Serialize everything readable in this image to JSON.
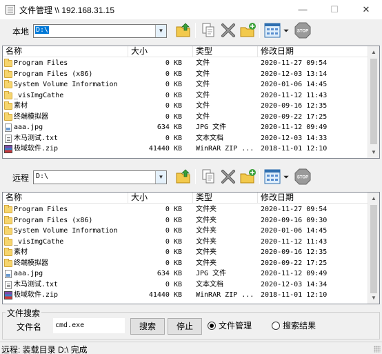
{
  "window": {
    "title": "文件管理 \\\\ 192.168.31.15",
    "min_glyph": "—",
    "max_glyph": "☐",
    "close_glyph": "✕"
  },
  "local": {
    "label": "本地",
    "path": "D:\\"
  },
  "remote": {
    "label": "远程",
    "path": "D:\\"
  },
  "toolbar": {
    "icons": [
      "folder-up-icon",
      "copy-icon",
      "delete-icon",
      "new-folder-icon",
      "view-mode-icon",
      "view-dropdown-icon",
      "stop-icon"
    ],
    "stop_label": "STOP"
  },
  "columns": {
    "name": "名称",
    "size": "大小",
    "type": "类型",
    "date": "修改日期"
  },
  "local_files": [
    {
      "icon": "folder",
      "name": "Program Files",
      "size": "0 KB",
      "type": "文件",
      "date": "2020-11-27 09:54"
    },
    {
      "icon": "folder",
      "name": "Program Files (x86)",
      "size": "0 KB",
      "type": "文件",
      "date": "2020-12-03 13:14"
    },
    {
      "icon": "folder",
      "name": "System Volume Information",
      "size": "0 KB",
      "type": "文件",
      "date": "2020-01-06 14:45"
    },
    {
      "icon": "folder",
      "name": "_visImgCathe",
      "size": "0 KB",
      "type": "文件",
      "date": "2020-11-12 11:43"
    },
    {
      "icon": "folder",
      "name": "素材",
      "size": "0 KB",
      "type": "文件",
      "date": "2020-09-16 12:35"
    },
    {
      "icon": "folder",
      "name": "终端模拟器",
      "size": "0 KB",
      "type": "文件",
      "date": "2020-09-22 17:25"
    },
    {
      "icon": "image",
      "name": "aaa.jpg",
      "size": "634 KB",
      "type": "JPG 文件",
      "date": "2020-11-12 09:49"
    },
    {
      "icon": "text",
      "name": "木马测试.txt",
      "size": "0 KB",
      "type": "文本文档",
      "date": "2020-12-03 14:33"
    },
    {
      "icon": "zip",
      "name": "极域软件.zip",
      "size": "41440 KB",
      "type": "WinRAR ZIP ...",
      "date": "2018-11-01 12:10"
    }
  ],
  "remote_files": [
    {
      "icon": "folder",
      "name": "Program Files",
      "size": "0 KB",
      "type": "文件夹",
      "date": "2020-11-27 09:54"
    },
    {
      "icon": "folder",
      "name": "Program Files (x86)",
      "size": "0 KB",
      "type": "文件夹",
      "date": "2020-09-16 09:30"
    },
    {
      "icon": "folder",
      "name": "System Volume Information",
      "size": "0 KB",
      "type": "文件夹",
      "date": "2020-01-06 14:45"
    },
    {
      "icon": "folder",
      "name": "_visImgCathe",
      "size": "0 KB",
      "type": "文件夹",
      "date": "2020-11-12 11:43"
    },
    {
      "icon": "folder",
      "name": "素材",
      "size": "0 KB",
      "type": "文件夹",
      "date": "2020-09-16 12:35"
    },
    {
      "icon": "folder",
      "name": "终端模拟器",
      "size": "0 KB",
      "type": "文件夹",
      "date": "2020-09-22 17:25"
    },
    {
      "icon": "image",
      "name": "aaa.jpg",
      "size": "634 KB",
      "type": "JPG 文件",
      "date": "2020-11-12 09:49"
    },
    {
      "icon": "text",
      "name": "木马测试.txt",
      "size": "0 KB",
      "type": "文本文档",
      "date": "2020-12-03 14:34"
    },
    {
      "icon": "zip",
      "name": "极域软件.zip",
      "size": "41440 KB",
      "type": "WinRAR ZIP ...",
      "date": "2018-11-01 12:10"
    }
  ],
  "search": {
    "group_label": "文件搜索",
    "filename_label": "文件名",
    "filename_value": "cmd.exe",
    "search_button": "搜索",
    "stop_button": "停止",
    "radio_file_manager": "文件管理",
    "radio_search_results": "搜索结果",
    "selected": "file_manager"
  },
  "status": {
    "text": "远程: 装载目录 D:\\ 完成"
  },
  "colors": {
    "selection": "#0078d7",
    "folder": "#f6d56e",
    "toolbar_green": "#3aa03a",
    "toolbar_yellow": "#f0c020"
  }
}
